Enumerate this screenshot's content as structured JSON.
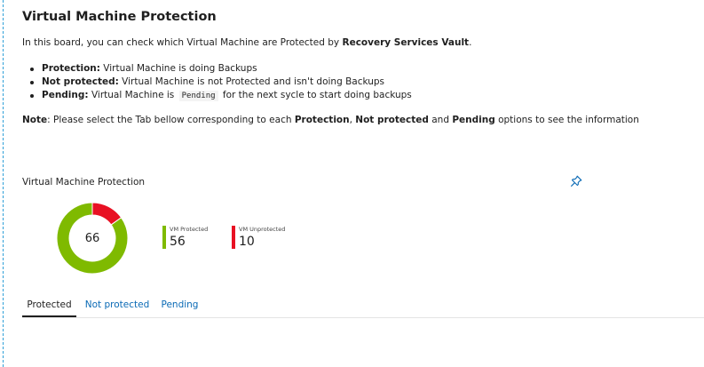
{
  "page": {
    "title": "Virtual Machine Protection",
    "intro": {
      "prefix": "In this board, you can check which Virtual Machine are Protected by ",
      "bold": "Recovery Services Vault",
      "suffix": "."
    },
    "bullets": [
      {
        "term": "Protection:",
        "text": " Virtual Machine is doing Backups"
      },
      {
        "term": "Not protected:",
        "text": " Virtual Machine is not Protected and isn't doing Backups"
      },
      {
        "term": "Pending:",
        "text": " Virtual Machine is ",
        "code": "Pending",
        "text_after": " for the next sycle to start doing backups"
      }
    ],
    "note": {
      "label": "Note",
      "t1": ": Please select the Tab bellow corresponding to each ",
      "b1": "Protection",
      "t2": ", ",
      "b2": "Not protected",
      "t3": " and ",
      "b3": "Pending",
      "t4": " options to see the information"
    }
  },
  "chart_title": "Virtual Machine Protection",
  "pin_icon": "pin-icon",
  "chart_data": {
    "type": "pie",
    "total_label": "66",
    "categories": [
      "VM Protected",
      "VM Unprotected"
    ],
    "values": [
      56,
      10
    ],
    "colors": [
      "#7fba00",
      "#e81123"
    ]
  },
  "legend": [
    {
      "label": "VM Protected",
      "value": "56",
      "color": "#7fba00"
    },
    {
      "label": "VM Unprotected",
      "value": "10",
      "color": "#e81123"
    }
  ],
  "tabs": [
    {
      "label": "Protected",
      "active": true
    },
    {
      "label": "Not protected",
      "active": false
    },
    {
      "label": "Pending",
      "active": false
    }
  ],
  "colors": {
    "accent_link": "#0a6ab5",
    "protected": "#7fba00",
    "unprotected": "#e81123",
    "board_border": "#2fa0d8"
  }
}
